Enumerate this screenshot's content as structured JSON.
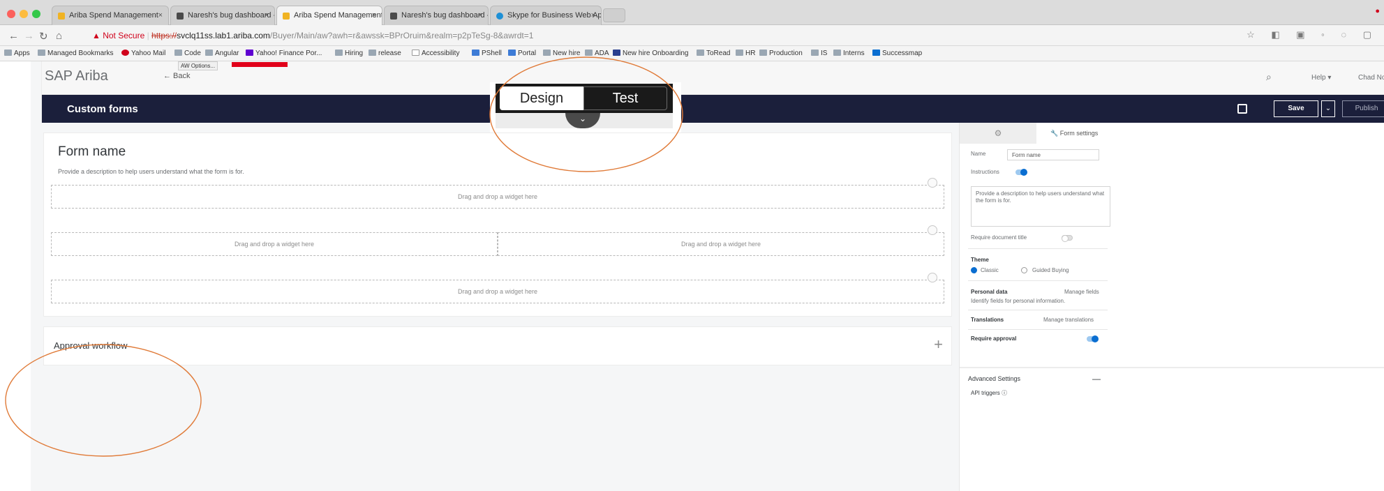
{
  "browser": {
    "tabs": [
      {
        "label": "Ariba Spend Management",
        "favicon_color": "#f0b323"
      },
      {
        "label": "Naresh's bug dashboard - SA",
        "favicon_color": "#4a4a4a"
      },
      {
        "label": "Ariba Spend Management",
        "favicon_color": "#f0b323"
      },
      {
        "label": "Naresh's bug dashboard - SA",
        "favicon_color": "#4a4a4a"
      },
      {
        "label": "Skype for Business Web App",
        "favicon_color": "#1e90d6"
      }
    ],
    "tab_close": "×",
    "url": {
      "warning": "▲ Not Secure",
      "scheme": "https://",
      "host": "svclq11ss.lab1.ariba.com",
      "path": "/Buyer/Main/aw?awh=r&awssk=BPrOruim&realm=p2pTeSg-8&awrdt=1"
    },
    "bookmarks": [
      "Apps",
      "Managed Bookmarks",
      "Yahoo Mail",
      "Code",
      "Angular",
      "Yahoo! Finance Por...",
      "Hiring",
      "release",
      "Accessibility",
      "PShell",
      "Portal",
      "New hire",
      "ADA",
      "New hire Onboarding",
      "ToRead",
      "HR",
      "Production",
      "IS",
      "Interns",
      "Successmap"
    ]
  },
  "app": {
    "brand": "SAP Ariba",
    "back_label": "← Back",
    "tooltip": "AW Options...",
    "help_label": "Help ▾",
    "user_label": "Chad No"
  },
  "shell": {
    "title": "Custom forms",
    "save_label": "Save",
    "save_caret": "⌄",
    "publish_label": "Publish"
  },
  "form": {
    "title": "Form name",
    "description": "Provide a description to help users understand what the form is for.",
    "drop_placeholder": "Drag and drop a widget here"
  },
  "approval": {
    "title": "Approval workflow",
    "add": "+"
  },
  "mode_switch": {
    "design_label": "Design",
    "test_label": "Test",
    "selected": "Design"
  },
  "settings_panel": {
    "tab_form_settings": "Form settings",
    "name_label": "Name",
    "name_value": "Form name",
    "instructions_label": "Instructions",
    "instructions_on": true,
    "instructions_text": "Provide a description to help users understand what the form is for.",
    "require_title_label": "Require document title",
    "require_title_on": false,
    "theme_label": "Theme",
    "theme_options": [
      "Classic",
      "Guided Buying"
    ],
    "theme_selected": "Classic",
    "personal_data_label": "Personal data",
    "manage_fields_link": "Manage fields",
    "personal_data_desc": "Identify fields for personal information.",
    "translations_label": "Translations",
    "manage_translations_link": "Manage translations",
    "require_approval_label": "Require approval",
    "require_approval_on": true,
    "advanced_label": "Advanced Settings",
    "advanced_collapse": "—",
    "api_triggers_label": "API triggers ⓘ"
  },
  "colors": {
    "shellbar": "#1b1f3b",
    "accent": "#0a6ed1",
    "annotation": "#e07b39"
  }
}
